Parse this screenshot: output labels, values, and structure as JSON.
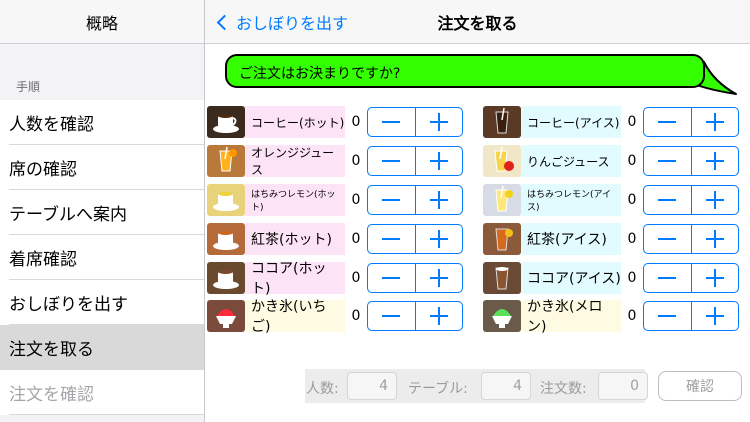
{
  "sidebar": {
    "title": "概略",
    "section_label": "手順",
    "items": [
      {
        "label": "人数を確認"
      },
      {
        "label": "席の確認"
      },
      {
        "label": "テーブルへ案内"
      },
      {
        "label": "着席確認"
      },
      {
        "label": "おしぼりを出す"
      },
      {
        "label": "注文を取る"
      },
      {
        "label": "注文を確認"
      }
    ]
  },
  "nav": {
    "back_label": "おしぼりを出す",
    "title": "注文を取る"
  },
  "bubble": {
    "text": "ご注文はお決まりですか?"
  },
  "menu": {
    "left": [
      {
        "label": "コーヒー(ホット)",
        "count": "0",
        "icon": "hot-coffee-icon"
      },
      {
        "label": "オレンジジュース",
        "count": "0",
        "icon": "orange-juice-icon"
      },
      {
        "label": "はちみつレモン(ホット)",
        "count": "0",
        "icon": "hot-honey-lemon-icon"
      },
      {
        "label": "紅茶(ホット)",
        "count": "0",
        "icon": "hot-tea-icon"
      },
      {
        "label": "ココア(ホット)",
        "count": "0",
        "icon": "hot-cocoa-icon"
      },
      {
        "label": "かき氷(いちご)",
        "count": "0",
        "icon": "strawberry-shaved-ice-icon"
      }
    ],
    "right": [
      {
        "label": "コーヒー(アイス)",
        "count": "0",
        "icon": "iced-coffee-icon"
      },
      {
        "label": "りんごジュース",
        "count": "0",
        "icon": "apple-juice-icon"
      },
      {
        "label": "はちみつレモン(アイス)",
        "count": "0",
        "icon": "iced-honey-lemon-icon"
      },
      {
        "label": "紅茶(アイス)",
        "count": "0",
        "icon": "iced-tea-icon"
      },
      {
        "label": "ココア(アイス)",
        "count": "0",
        "icon": "iced-cocoa-icon"
      },
      {
        "label": "かき氷(メロン)",
        "count": "0",
        "icon": "melon-shaved-ice-icon"
      }
    ]
  },
  "footer": {
    "people_label": "人数:",
    "people_value": "4",
    "table_label": "テーブル:",
    "table_value": "4",
    "orders_label": "注文数:",
    "orders_value": "0",
    "confirm_label": "確認"
  },
  "colors": {
    "accent": "#007aff",
    "bubble": "#33ff00",
    "row_pink": "#fde3f6",
    "row_cyan": "#e2fbff",
    "row_yellow": "#fffbe2"
  }
}
